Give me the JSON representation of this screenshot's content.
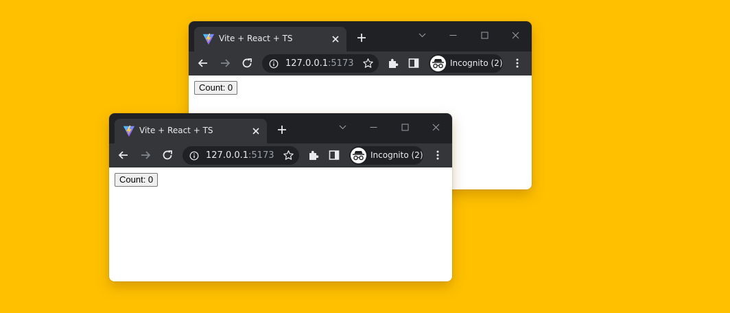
{
  "colors": {
    "background": "#FFC000",
    "titlebar": "#202124",
    "toolbar": "#35363a",
    "text": "#e8eaed",
    "muted": "#9aa0a6"
  },
  "windows": [
    {
      "tab": {
        "title": "Vite + React + TS",
        "favicon": "vite-logo-icon"
      },
      "address": {
        "host": "127.0.0.1",
        "port": ":5173"
      },
      "incognito_label": "Incognito (2)",
      "page": {
        "count_label": "Count: 0"
      }
    },
    {
      "tab": {
        "title": "Vite + React + TS",
        "favicon": "vite-logo-icon"
      },
      "address": {
        "host": "127.0.0.1",
        "port": ":5173"
      },
      "incognito_label": "Incognito (2)",
      "page": {
        "count_label": "Count: 0"
      }
    }
  ]
}
